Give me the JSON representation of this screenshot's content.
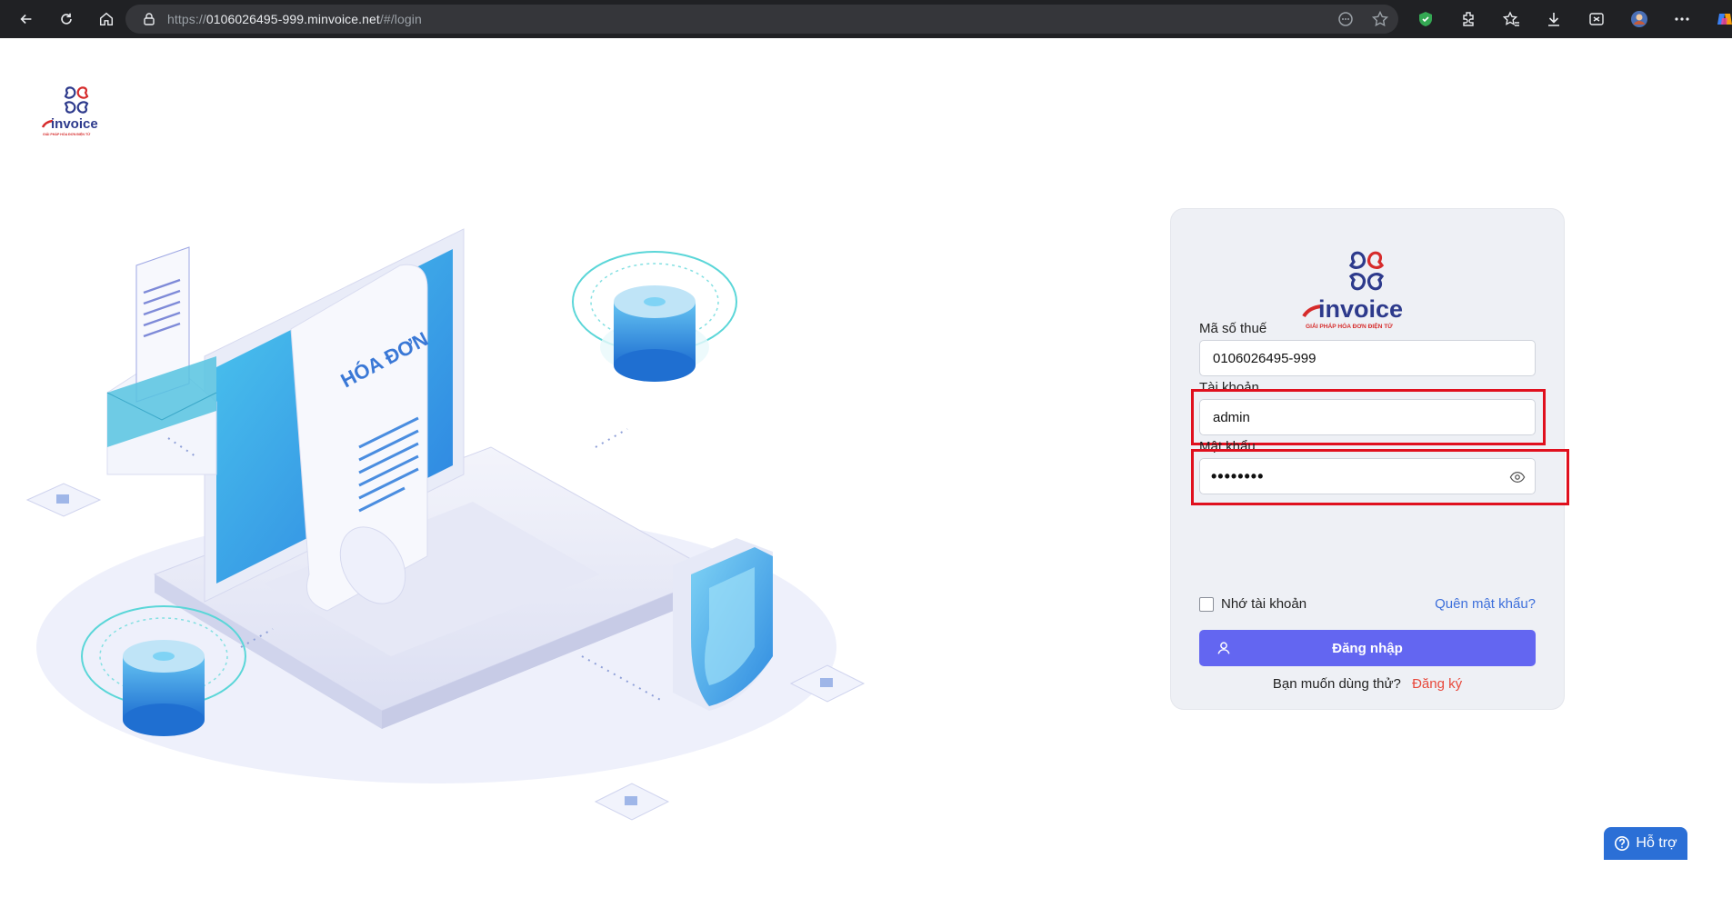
{
  "browser": {
    "url_scheme": "https://",
    "url_host": "0106026495-999.minvoice.net",
    "url_path": "/#/login"
  },
  "logo": {
    "brand": "invoice",
    "tagline": "GIẢI PHÁP HÓA ĐƠN ĐIỆN TỬ"
  },
  "illustration": {
    "document_text": "HÓA ĐƠN"
  },
  "form": {
    "tax_code_label": "Mã số thuế",
    "tax_code_value": "0106026495-999",
    "account_label": "Tài khoản",
    "account_value": "admin",
    "password_label": "Mật khẩu",
    "password_value": "••••••••",
    "remember_label": "Nhớ tài khoản",
    "forgot_label": "Quên mật khẩu?",
    "login_label": "Đăng nhập",
    "trial_text": "Bạn muốn dùng thử?",
    "signup_label": "Đăng ký"
  },
  "support": {
    "label": "Hỗ trợ"
  },
  "colors": {
    "primary": "#6366f1",
    "link": "#3d6fdb",
    "signup": "#e8483b",
    "highlight": "#e0101e",
    "support": "#2b6fd6"
  }
}
